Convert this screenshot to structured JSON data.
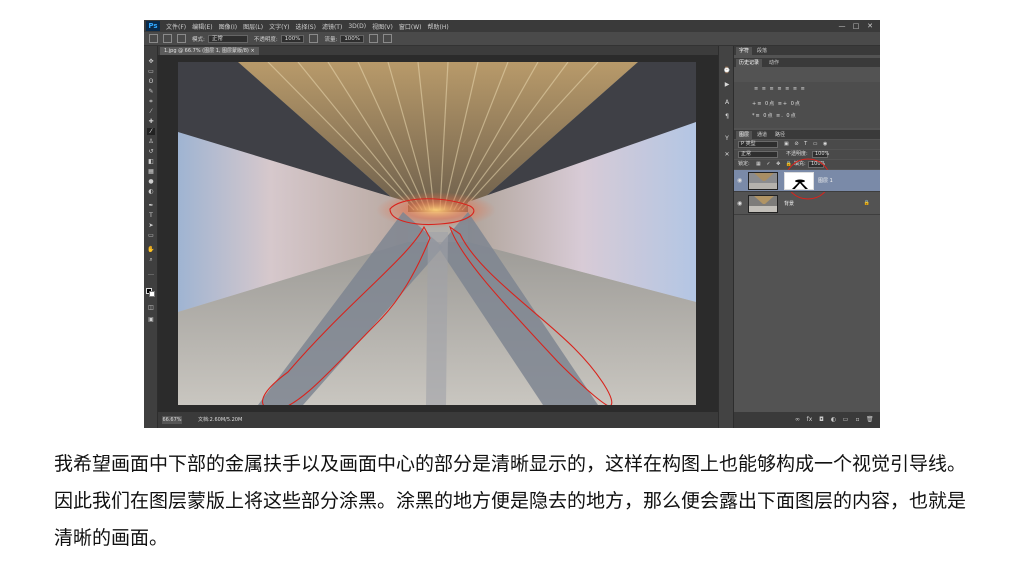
{
  "photoshop": {
    "logo": "Ps",
    "menu": [
      "文件(F)",
      "编辑(E)",
      "图像(I)",
      "图层(L)",
      "文字(Y)",
      "选择(S)",
      "滤镜(T)",
      "3D(D)",
      "视图(V)",
      "窗口(W)",
      "帮助(H)"
    ],
    "window_controls": [
      "—",
      "□",
      "✕"
    ],
    "options_bar": {
      "mode_label": "模式:",
      "mode_value": "正常",
      "opacity_label": "不透明度:",
      "opacity_value": "100%",
      "flow_label": "流量:",
      "flow_value": "100%"
    },
    "document_tab": "1.jpg @ 66.7% (图层 1, 图层蒙版/8) ×",
    "status": {
      "zoom": "66.67%",
      "doc": "文档:2.60M/5.20M"
    },
    "panels": {
      "top_tabs": [
        "字符",
        "段落"
      ],
      "second_tabs": [
        "历史记录",
        "动作"
      ],
      "paragraph_row1": "≡ ≡ ≡ ≡ ≡ ≡ ≡",
      "paragraph_row2": "+≡ 0点   ≡+ 0点",
      "paragraph_row3": "*≡ 0点   ≡. 0点",
      "layers_tabs": [
        "图层",
        "通道",
        "路径"
      ],
      "filter_label": "P 类型",
      "blend_mode": "正常",
      "opacity_label": "不透明度:",
      "opacity_value": "100%",
      "lock_label": "锁定:",
      "fill_label": "填充:",
      "fill_value": "100%",
      "layers": [
        {
          "name": "图层 1",
          "selected": true,
          "has_mask": true
        },
        {
          "name": "背景",
          "selected": false,
          "has_mask": false,
          "locked": true
        }
      ]
    }
  },
  "caption": "我希望画面中下部的金属扶手以及画面中心的部分是清晰显示的，这样在构图上也能够构成一个视觉引导线。因此我们在图层蒙版上将这些部分涂黑。涂黑的地方便是隐去的地方，那么便会露出下面图层的内容，也就是清晰的画面。",
  "colors": {
    "ps_background": "#535353",
    "selected_layer": "#7a8aa8",
    "annotation_red": "#d9231c"
  }
}
